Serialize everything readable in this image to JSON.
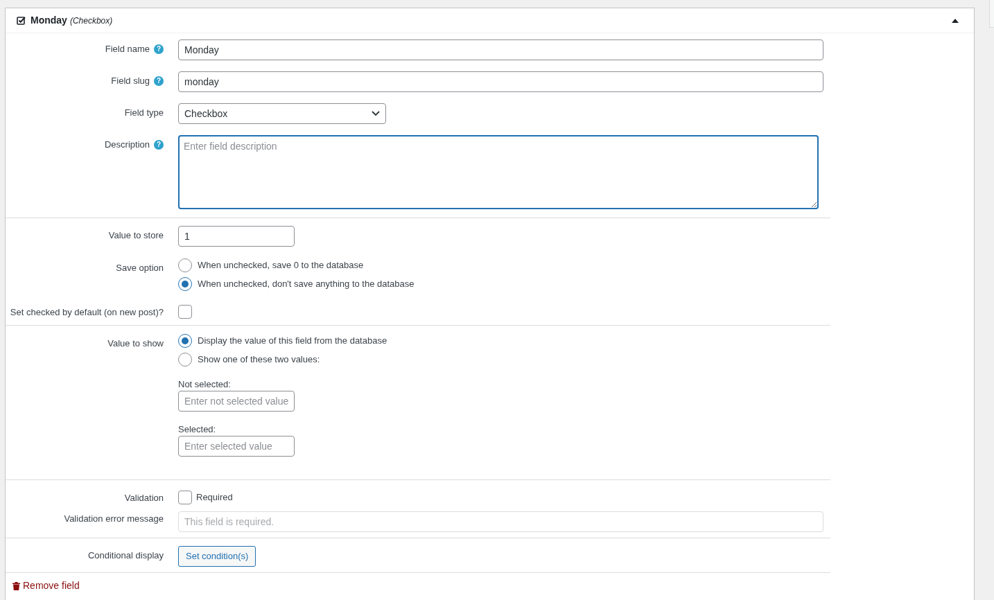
{
  "header": {
    "title": "Monday",
    "type": "(Checkbox)",
    "expanded": true
  },
  "sections": [
    {
      "rows": [
        {
          "kind": "text",
          "label": "Field name",
          "help": "?",
          "value": "Monday"
        },
        {
          "kind": "text",
          "label": "Field slug",
          "help": "?",
          "value": "monday"
        },
        {
          "kind": "select",
          "label": "Field type",
          "value": "Checkbox"
        },
        {
          "kind": "textarea",
          "label": "Description",
          "help": "?",
          "placeholder": "Enter field description",
          "focused": true
        }
      ]
    },
    {
      "rows": [
        {
          "kind": "short",
          "label": "Value to store",
          "value": "1"
        },
        {
          "kind": "radios",
          "label": "Save option",
          "options": [
            {
              "label": "When unchecked, save 0 to the database",
              "selected": false
            },
            {
              "label": "When unchecked, don't save anything to the database",
              "selected": true
            }
          ]
        },
        {
          "kind": "checkbox",
          "label": "Set checked by default (on new post)?",
          "checked": false
        }
      ]
    },
    {
      "rows": [
        {
          "kind": "radios",
          "label": "Value to show",
          "options": [
            {
              "label": "Display the value of this field from the database",
              "selected": true
            },
            {
              "label": "Show one of these two values:",
              "selected": false
            }
          ],
          "subfields": [
            {
              "caption": "Not selected:",
              "placeholder": "Enter not selected value"
            },
            {
              "caption": "Selected:",
              "placeholder": "Enter selected value"
            }
          ]
        }
      ]
    },
    {
      "rows": [
        {
          "kind": "checkbox",
          "label": "Validation",
          "checked": false,
          "text": "Required"
        },
        {
          "kind": "disabled",
          "label": "Validation error message",
          "placeholder": "This field is required."
        }
      ]
    },
    {
      "rows": [
        {
          "kind": "button",
          "label": "Conditional display",
          "text": "Set condition(s)"
        }
      ]
    }
  ],
  "remove": {
    "text": "Remove field"
  }
}
